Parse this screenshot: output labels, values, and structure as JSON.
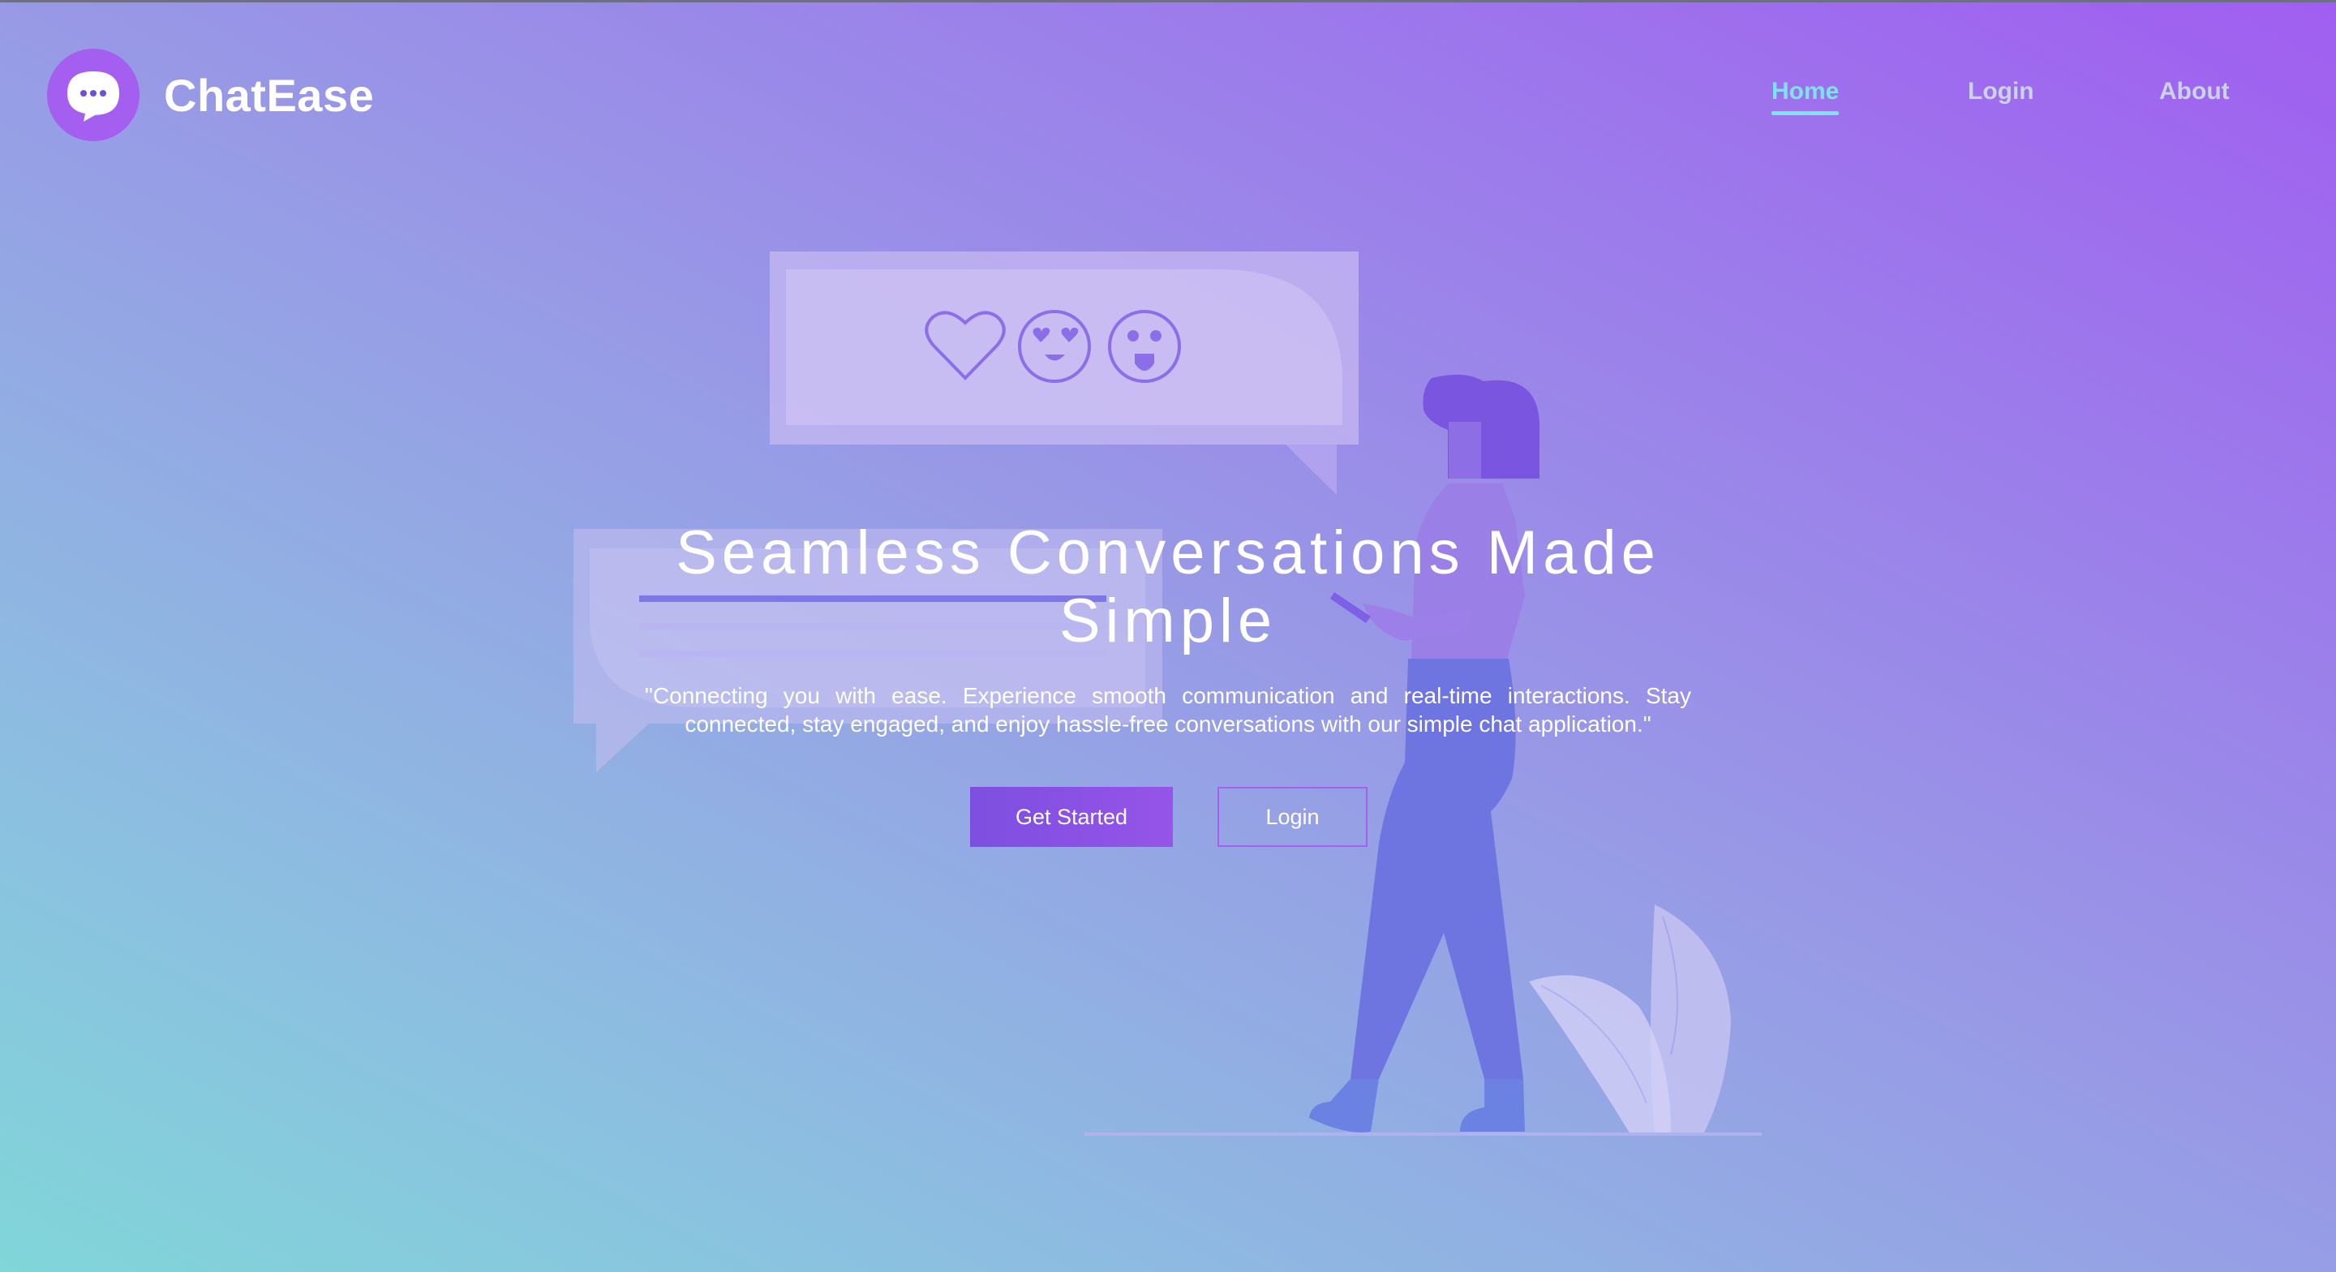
{
  "brand": {
    "name": "ChatEase",
    "logo_icon": "chat-bubble-icon",
    "logo_color": "#a45ef0"
  },
  "nav": {
    "links": [
      {
        "label": "Home",
        "active": true
      },
      {
        "label": "Login",
        "active": false
      },
      {
        "label": "About",
        "active": false
      }
    ],
    "active_color": "#7ee3f0"
  },
  "hero": {
    "title": "Seamless Conversations Made Simple",
    "subtitle": "\"Connecting you with ease. Experience smooth communication and real-time interactions. Stay connected, stay engaged, and enjoy hassle-free conversations with our simple chat application.\"",
    "primary_button": "Get Started",
    "secondary_button": "Login"
  },
  "illustration": {
    "icons": [
      "heart-icon",
      "heart-eyes-face-icon",
      "tongue-out-face-icon"
    ]
  },
  "colors": {
    "accent": "#a45ef0",
    "button_primary": "#8752e4",
    "gradient_start": "#80d6d9",
    "gradient_end": "#a05ef0"
  }
}
